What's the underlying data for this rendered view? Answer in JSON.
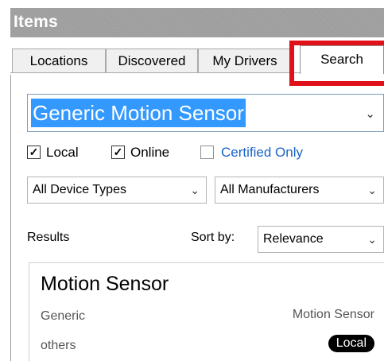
{
  "panel": {
    "title": "Items"
  },
  "tabs": [
    {
      "label": "Locations"
    },
    {
      "label": "Discovered"
    },
    {
      "label": "My Drivers"
    },
    {
      "label": "Search"
    }
  ],
  "search": {
    "query": "Generic Motion Sensor"
  },
  "filters": {
    "local": {
      "label": "Local",
      "checked": true
    },
    "online": {
      "label": "Online",
      "checked": true
    },
    "certified_only": {
      "label": "Certified Only",
      "checked": false
    }
  },
  "device_type_select": {
    "value": "All Device Types"
  },
  "manufacturer_select": {
    "value": "All Manufacturers"
  },
  "results": {
    "label": "Results",
    "sort_label": "Sort by:",
    "sort_value": "Relevance",
    "items": [
      {
        "name": "Motion Sensor",
        "manufacturer": "Generic",
        "device_type": "Motion Sensor",
        "category": "others",
        "badge": "Local"
      }
    ]
  },
  "colors": {
    "header_bg": "#9d9d9d",
    "selection": "#3399ff",
    "highlight": "#e1111a",
    "link": "#1a64c8"
  },
  "icons": {
    "dropdown": "chevron-down-icon",
    "check": "checkmark-icon"
  }
}
